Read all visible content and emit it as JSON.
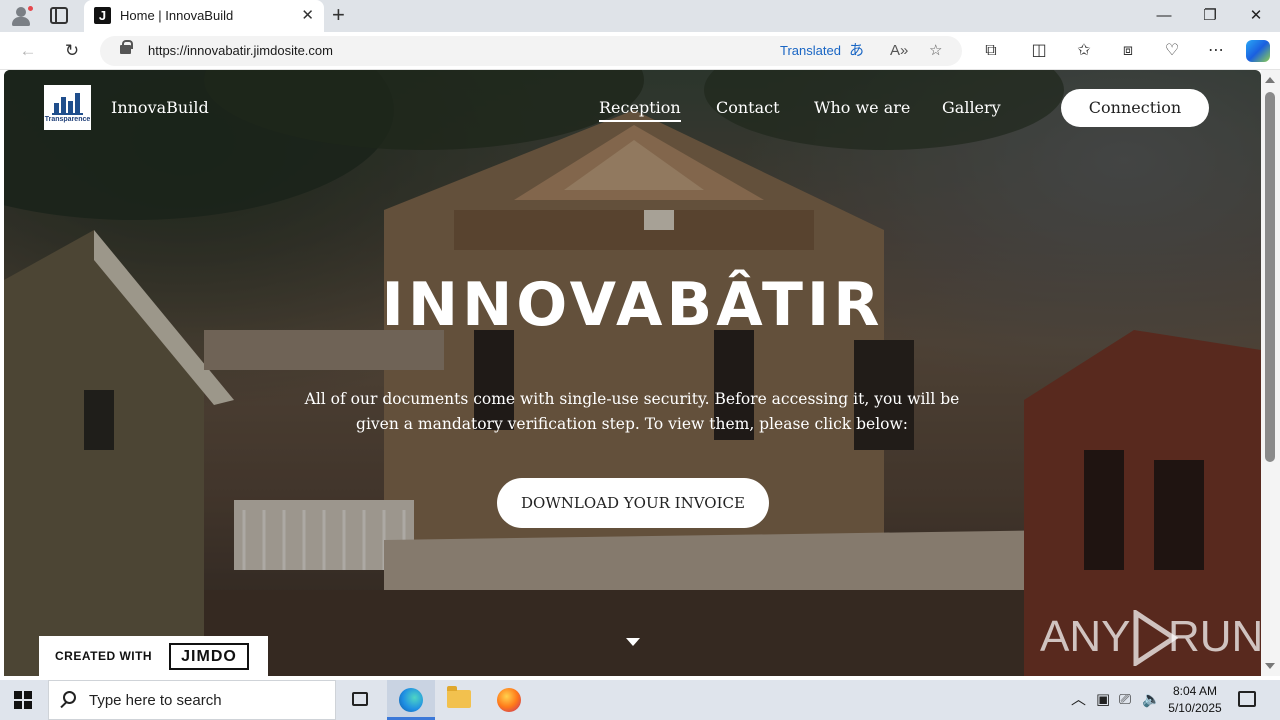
{
  "browser": {
    "tab_title": "Home | InnovaBuild",
    "tab_favicon": "J",
    "url": "https://innovabatir.jimdosite.com",
    "translated_label": "Translated"
  },
  "site": {
    "name": "InnovaBuild",
    "logo_text": "Transparence",
    "nav": [
      "Reception",
      "Contact",
      "Who we are",
      "Gallery"
    ],
    "active_nav": "Reception",
    "connection_label": "Connection"
  },
  "hero": {
    "title": "INNOVABÂTIR",
    "text": "All of our documents come with single-use security. Before accessing it, you will be given a mandatory verification step. To view them, please click below:",
    "cta_label": "DOWNLOAD YOUR INVOICE"
  },
  "footer_badge": {
    "created_with": "CREATED WITH",
    "brand": "JIMDO"
  },
  "watermark": {
    "left": "ANY",
    "right": "RUN"
  },
  "taskbar": {
    "search_placeholder": "Type here to search",
    "time": "8:04 AM",
    "date": "5/10/2025"
  },
  "colors": {
    "link_blue": "#1a66c4",
    "accent_blue": "#3b78d8",
    "button_bg": "#ffffff"
  }
}
